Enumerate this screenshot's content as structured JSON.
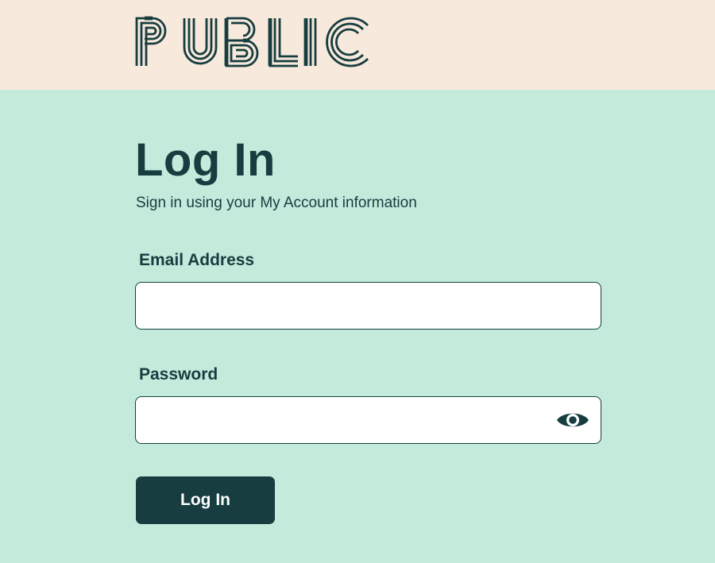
{
  "header": {
    "logo_text": "PUBLIC"
  },
  "colors": {
    "header_background": "#f7e9dc",
    "page_background": "#c3eadb",
    "primary": "#173d40",
    "field_background": "#ffffff",
    "button_text": "#ffffff"
  },
  "login": {
    "title": "Log In",
    "subtitle": "Sign in using your My Account information",
    "email": {
      "label": "Email Address",
      "value": "",
      "placeholder": ""
    },
    "password": {
      "label": "Password",
      "value": "",
      "placeholder": "",
      "toggle_icon": "eye-icon"
    },
    "submit_label": "Log In"
  }
}
